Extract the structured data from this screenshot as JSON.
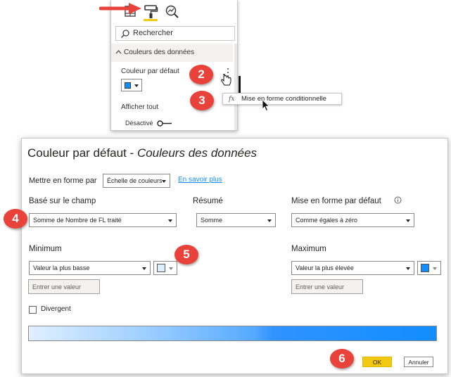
{
  "pane": {
    "search_placeholder": "Rechercher",
    "section_title": "Couleurs des données",
    "default_color_label": "Couleur par défaut",
    "default_color_value": "#118dff",
    "show_all_label": "Afficher tout",
    "toggle_label": "Désactivé",
    "toggle_state": "off",
    "icons": [
      "fields-icon",
      "format-paintroller-icon",
      "analytics-icon"
    ]
  },
  "context_menu": {
    "fx_glyph": "fx",
    "item_label": "Mise en forme conditionnelle"
  },
  "dialog": {
    "title_main": "Couleur par défaut",
    "title_sep": " - ",
    "title_sub": "Couleurs des données",
    "format_by_label": "Mettre en forme par",
    "format_by_value": "Échelle de couleurs",
    "learn_more": "En savoir plus",
    "field_label": "Basé sur le champ",
    "field_value": "Somme de Nombre de FL traité",
    "summary_label": "Résumé",
    "summary_value": "Somme",
    "default_format_label": "Mise en forme par défaut",
    "default_format_value": "Comme égales à zéro",
    "minimum_label": "Minimum",
    "minimum_value": "Valeur la plus basse",
    "minimum_color": "#deeeff",
    "minimum_input_placeholder": "Entrer une valeur",
    "maximum_label": "Maximum",
    "maximum_value": "Valeur la plus élevée",
    "maximum_color": "#118dff",
    "maximum_input_placeholder": "Entrer une valeur",
    "divergent_label": "Divergent",
    "divergent_checked": false,
    "ok_label": "OK",
    "cancel_label": "Annuler"
  },
  "callouts": [
    "2",
    "3",
    "4",
    "5",
    "6"
  ],
  "colors": {
    "accent_yellow": "#f2c811",
    "callout_red": "#e8423b",
    "link_blue": "#118dff"
  }
}
